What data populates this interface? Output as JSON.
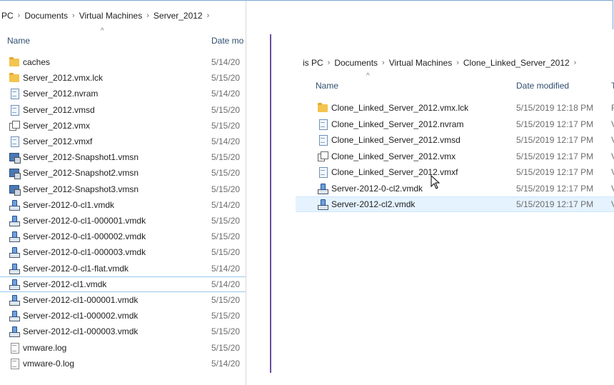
{
  "left": {
    "breadcrumb": [
      "PC",
      "Documents",
      "Virtual Machines",
      "Server_2012"
    ],
    "columns": {
      "name": "Name",
      "date": "Date mo"
    },
    "files": [
      {
        "name": "caches",
        "icon": "folder-icon",
        "date": "5/14/20"
      },
      {
        "name": "Server_2012.vmx.lck",
        "icon": "folder-icon",
        "date": "5/15/20"
      },
      {
        "name": "Server_2012.nvram",
        "icon": "document-icon",
        "date": "5/14/20"
      },
      {
        "name": "Server_2012.vmsd",
        "icon": "document-icon",
        "date": "5/15/20"
      },
      {
        "name": "Server_2012.vmx",
        "icon": "vmx-icon",
        "date": "5/15/20"
      },
      {
        "name": "Server_2012.vmxf",
        "icon": "document-icon",
        "date": "5/14/20"
      },
      {
        "name": "Server_2012-Snapshot1.vmsn",
        "icon": "snapshot-icon",
        "date": "5/15/20"
      },
      {
        "name": "Server_2012-Snapshot2.vmsn",
        "icon": "snapshot-icon",
        "date": "5/15/20"
      },
      {
        "name": "Server_2012-Snapshot3.vmsn",
        "icon": "snapshot-icon",
        "date": "5/15/20"
      },
      {
        "name": "Server-2012-0-cl1.vmdk",
        "icon": "vmdk-icon",
        "date": "5/14/20"
      },
      {
        "name": "Server-2012-0-cl1-000001.vmdk",
        "icon": "vmdk-icon",
        "date": "5/15/20"
      },
      {
        "name": "Server-2012-0-cl1-000002.vmdk",
        "icon": "vmdk-icon",
        "date": "5/15/20"
      },
      {
        "name": "Server-2012-0-cl1-000003.vmdk",
        "icon": "vmdk-icon",
        "date": "5/15/20"
      },
      {
        "name": "Server-2012-0-cl1-flat.vmdk",
        "icon": "vmdk-icon",
        "date": "5/14/20"
      },
      {
        "name": "Server-2012-cl1.vmdk",
        "icon": "vmdk-icon",
        "date": "5/14/20"
      },
      {
        "name": "Server-2012-cl1-000001.vmdk",
        "icon": "vmdk-icon",
        "date": "5/15/20"
      },
      {
        "name": "Server-2012-cl1-000002.vmdk",
        "icon": "vmdk-icon",
        "date": "5/15/20"
      },
      {
        "name": "Server-2012-cl1-000003.vmdk",
        "icon": "vmdk-icon",
        "date": "5/15/20"
      },
      {
        "name": "vmware.log",
        "icon": "log-icon",
        "date": "5/15/20"
      },
      {
        "name": "vmware-0.log",
        "icon": "log-icon",
        "date": "5/14/20"
      }
    ]
  },
  "right": {
    "breadcrumb": [
      "is PC",
      "Documents",
      "Virtual Machines",
      "Clone_Linked_Server_2012"
    ],
    "columns": {
      "name": "Name",
      "date": "Date modified",
      "type": "T"
    },
    "files": [
      {
        "name": "Clone_Linked_Server_2012.vmx.lck",
        "icon": "folder-icon",
        "date": "5/15/2019 12:18 PM",
        "type": "F"
      },
      {
        "name": "Clone_Linked_Server_2012.nvram",
        "icon": "document-icon",
        "date": "5/15/2019 12:17 PM",
        "type": "V"
      },
      {
        "name": "Clone_Linked_Server_2012.vmsd",
        "icon": "document-icon",
        "date": "5/15/2019 12:17 PM",
        "type": "V"
      },
      {
        "name": "Clone_Linked_Server_2012.vmx",
        "icon": "vmx-icon",
        "date": "5/15/2019 12:17 PM",
        "type": "V"
      },
      {
        "name": "Clone_Linked_Server_2012.vmxf",
        "icon": "document-icon",
        "date": "5/15/2019 12:17 PM",
        "type": "V"
      },
      {
        "name": "Server-2012-0-cl2.vmdk",
        "icon": "vmdk-icon",
        "date": "5/15/2019 12:17 PM",
        "type": "V"
      },
      {
        "name": "Server-2012-cl2.vmdk",
        "icon": "vmdk-icon",
        "date": "5/15/2019 12:17 PM",
        "type": "V"
      }
    ]
  }
}
